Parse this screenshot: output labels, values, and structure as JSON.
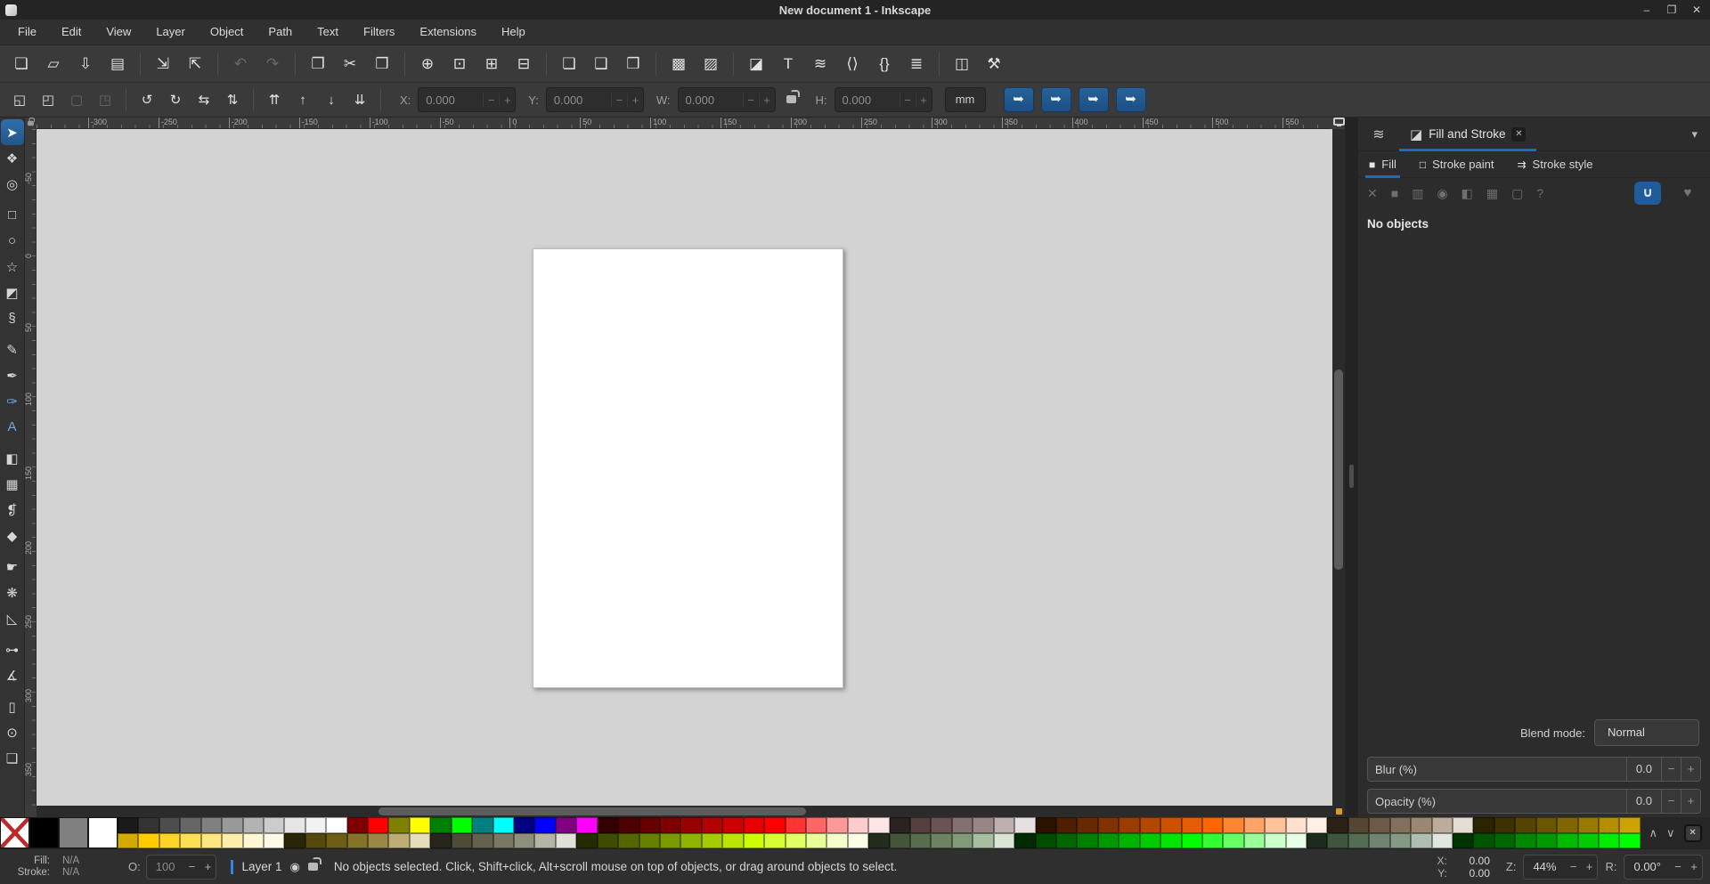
{
  "window": {
    "title": "New document 1 - Inkscape",
    "controls": [
      {
        "name": "minimize",
        "glyph": "–"
      },
      {
        "name": "restore",
        "glyph": "❐"
      },
      {
        "name": "close",
        "glyph": "✕"
      }
    ]
  },
  "menu": {
    "items": [
      "File",
      "Edit",
      "View",
      "Layer",
      "Object",
      "Path",
      "Text",
      "Filters",
      "Extensions",
      "Help"
    ]
  },
  "command_toolbar": {
    "groups": [
      [
        {
          "name": "new-document",
          "glyph": "❏"
        },
        {
          "name": "open-document",
          "glyph": "▱"
        },
        {
          "name": "save-document",
          "glyph": "⇩"
        },
        {
          "name": "print-document",
          "glyph": "▤"
        }
      ],
      [
        {
          "name": "import",
          "glyph": "⇲"
        },
        {
          "name": "export",
          "glyph": "⇱"
        }
      ],
      [
        {
          "name": "undo",
          "glyph": "↶",
          "disabled": true
        },
        {
          "name": "redo",
          "glyph": "↷",
          "disabled": true
        }
      ],
      [
        {
          "name": "copy",
          "glyph": "❐"
        },
        {
          "name": "cut",
          "glyph": "✂"
        },
        {
          "name": "paste",
          "glyph": "❒"
        }
      ],
      [
        {
          "name": "zoom-to-selection",
          "glyph": "⊕"
        },
        {
          "name": "zoom-to-drawing",
          "glyph": "⊡"
        },
        {
          "name": "zoom-to-page",
          "glyph": "⊞"
        },
        {
          "name": "zoom-page-width",
          "glyph": "⊟"
        }
      ],
      [
        {
          "name": "duplicate",
          "glyph": "❏"
        },
        {
          "name": "create-clone",
          "glyph": "❑"
        },
        {
          "name": "unlink-clone",
          "glyph": "❒"
        }
      ],
      [
        {
          "name": "group",
          "glyph": "▩"
        },
        {
          "name": "ungroup",
          "glyph": "▨"
        }
      ],
      [
        {
          "name": "fill-stroke-dialog",
          "glyph": "◪"
        },
        {
          "name": "text-dialog",
          "glyph": "T"
        },
        {
          "name": "layers-dialog",
          "glyph": "≋"
        },
        {
          "name": "xml-editor",
          "glyph": "⟨⟩"
        },
        {
          "name": "selectors-dialog",
          "glyph": "{}"
        },
        {
          "name": "align-distribute-dialog",
          "glyph": "≣"
        }
      ],
      [
        {
          "name": "document-properties",
          "glyph": "◫"
        },
        {
          "name": "preferences",
          "glyph": "⚒"
        }
      ]
    ]
  },
  "tool_controls": {
    "button_groups": [
      [
        {
          "name": "select-all",
          "glyph": "◱"
        },
        {
          "name": "select-all-layers",
          "glyph": "◰"
        },
        {
          "name": "deselect",
          "glyph": "▢",
          "disabled": true
        },
        {
          "name": "selection-cue-toggle",
          "glyph": "◳",
          "disabled": true
        }
      ],
      [
        {
          "name": "rotate-ccw",
          "glyph": "↺"
        },
        {
          "name": "rotate-cw",
          "glyph": "↻"
        },
        {
          "name": "flip-horizontal",
          "glyph": "⇆"
        },
        {
          "name": "flip-vertical",
          "glyph": "⇅"
        }
      ],
      [
        {
          "name": "raise-to-top",
          "glyph": "⇈"
        },
        {
          "name": "raise",
          "glyph": "↑"
        },
        {
          "name": "lower",
          "glyph": "↓"
        },
        {
          "name": "lower-to-bottom",
          "glyph": "⇊"
        }
      ]
    ],
    "fields": {
      "x": {
        "label": "X:",
        "value": "0.000"
      },
      "y": {
        "label": "Y:",
        "value": "0.000"
      },
      "w": {
        "label": "W:",
        "value": "0.000"
      },
      "h": {
        "label": "H:",
        "value": "0.000"
      }
    },
    "unit": "mm",
    "toggles": [
      {
        "name": "scale-stroke-width",
        "glyph": "➥"
      },
      {
        "name": "scale-rounded-corners",
        "glyph": "➥"
      },
      {
        "name": "move-gradients",
        "glyph": "➥"
      },
      {
        "name": "move-patterns",
        "glyph": "➥"
      }
    ]
  },
  "toolbox": {
    "tools": [
      {
        "name": "selector",
        "glyph": "➤",
        "active": true
      },
      {
        "name": "node-editor",
        "glyph": "❖"
      },
      {
        "name": "shape-builder",
        "glyph": "◎"
      },
      {
        "name": "rectangle",
        "glyph": "□",
        "grp": true
      },
      {
        "name": "ellipse",
        "glyph": "○"
      },
      {
        "name": "star",
        "glyph": "☆"
      },
      {
        "name": "box-3d",
        "glyph": "◩"
      },
      {
        "name": "spiral",
        "glyph": "§"
      },
      {
        "name": "pencil",
        "glyph": "✎",
        "grp": true
      },
      {
        "name": "pen",
        "glyph": "✒"
      },
      {
        "name": "calligraphy",
        "glyph": "✑"
      },
      {
        "name": "text",
        "glyph": "A"
      },
      {
        "name": "gradient",
        "glyph": "◧",
        "grp": true
      },
      {
        "name": "mesh-gradient",
        "glyph": "▦"
      },
      {
        "name": "dropper",
        "glyph": "❡"
      },
      {
        "name": "paint-bucket",
        "glyph": "◆"
      },
      {
        "name": "tweak",
        "glyph": "☛",
        "grp": true
      },
      {
        "name": "spray",
        "glyph": "❋"
      },
      {
        "name": "eraser",
        "glyph": "◺"
      },
      {
        "name": "connector",
        "glyph": "⊶",
        "grp": true
      },
      {
        "name": "measure",
        "glyph": "∡"
      },
      {
        "name": "page",
        "glyph": "▯",
        "grp": true
      },
      {
        "name": "zoom",
        "glyph": "⊙"
      },
      {
        "name": "pages",
        "glyph": "❏"
      }
    ]
  },
  "rulers": {
    "horizontal": [
      "-300",
      "-250",
      "-200",
      "-150",
      "-100",
      "-50",
      "0",
      "50",
      "100",
      "150",
      "200",
      "250",
      "300",
      "350",
      "400",
      "450",
      "500",
      "550"
    ],
    "vertical": [
      "-50",
      "0",
      "50",
      "100",
      "150",
      "200",
      "250",
      "300",
      "350"
    ]
  },
  "canvas": {
    "desk_color": "#d3d3d3",
    "page_color": "#ffffff"
  },
  "panel": {
    "dock_tab": "Fill and Stroke",
    "tabs": [
      {
        "name": "fill",
        "label": "Fill",
        "glyph": "■",
        "active": true
      },
      {
        "name": "stroke-paint",
        "label": "Stroke paint",
        "glyph": "□"
      },
      {
        "name": "stroke-style",
        "label": "Stroke style",
        "glyph": "⇉"
      }
    ],
    "paint_types": [
      {
        "name": "no-paint",
        "glyph": "✕"
      },
      {
        "name": "flat-color",
        "glyph": "■"
      },
      {
        "name": "linear-gradient",
        "glyph": "▥"
      },
      {
        "name": "radial-gradient",
        "glyph": "◉"
      },
      {
        "name": "pattern",
        "glyph": "◧"
      },
      {
        "name": "swatch",
        "glyph": "▦"
      },
      {
        "name": "unknown-paint",
        "glyph": "▢"
      },
      {
        "name": "paint-help",
        "glyph": "?"
      }
    ],
    "fill_rule": [
      {
        "name": "fill-rule-nonzero",
        "glyph": "∪",
        "active": true
      },
      {
        "name": "fill-rule-evenodd",
        "glyph": "♥"
      }
    ],
    "status": "No objects",
    "blend_label": "Blend mode:",
    "blend_value": "Normal",
    "blur_label": "Blur (%)",
    "blur_value": "0.0",
    "opacity_label": "Opacity (%)",
    "opacity_value": "0.0"
  },
  "palette": {
    "specials": [
      "none",
      "#000000",
      "#808080",
      "#ffffff"
    ],
    "row1": [
      "1a1a1a",
      "333333",
      "4d4d4d",
      "666666",
      "808080",
      "999999",
      "b3b3b3",
      "cccccc",
      "e6e6e6",
      "f2f2f2",
      "ffffff",
      "800000",
      "ff0000",
      "808000",
      "ffff00",
      "008000",
      "00ff00",
      "008080",
      "00ffff",
      "000080",
      "0000ff",
      "800080",
      "ff00ff",
      "330000",
      "4d0000",
      "660000",
      "800000",
      "990000",
      "b30000",
      "cc0000",
      "e60000",
      "ff0000",
      "ff3333",
      "ff6666",
      "ff9999",
      "ffcccc",
      "ffe6e6",
      "2b2222",
      "553f3f",
      "6c5353",
      "837070",
      "9a8585",
      "beb0b0",
      "e6e0e0",
      "2b1100",
      "4d1f00",
      "662900",
      "803300",
      "993d00",
      "b34700",
      "cc5200",
      "e65c00",
      "ff6600",
      "ff8533",
      "ffa366",
      "ffc299",
      "ffe0cc",
      "fff0e6",
      "2b2016",
      "554633",
      "6c5a47",
      "83705c",
      "9a8671",
      "beac9b",
      "e6ddd5",
      "2b2200",
      "3d3100",
      "554400",
      "6b5600",
      "806600",
      "997a00",
      "b38f00",
      "cca300"
    ],
    "row2": [
      "d4aa00",
      "ffcc00",
      "ffd42a",
      "ffdd55",
      "ffe680",
      "ffeeaa",
      "fff6d5",
      "fffbe6",
      "2b2507",
      "554a0e",
      "6c5e15",
      "837326",
      "9a8844",
      "beae76",
      "e6ddba",
      "26261d",
      "4c4c37",
      "62624f",
      "787865",
      "8f8f7d",
      "b5b5a6",
      "e0e0d8",
      "232b00",
      "3f4d00",
      "536600",
      "688000",
      "7c9900",
      "90b300",
      "a5cc00",
      "b9e600",
      "ccff00",
      "d6ff33",
      "e0ff66",
      "ebff99",
      "f5ffcc",
      "faffe6",
      "242b1c",
      "45553a",
      "596c4e",
      "6d8362",
      "829a77",
      "a8bea0",
      "dae6d5",
      "002b00",
      "004d00",
      "006600",
      "008000",
      "009900",
      "00b300",
      "00cc00",
      "00e600",
      "00ff00",
      "33ff33",
      "66ff66",
      "99ff99",
      "ccffcc",
      "e6ffe6",
      "1d2b1d",
      "3f553f",
      "536c53",
      "708370",
      "859a85",
      "b0beb0",
      "e0e6e0",
      "003300",
      "005500",
      "006600",
      "008800",
      "009900",
      "00bb00",
      "00cc00",
      "00ee00",
      "00ff00"
    ]
  },
  "statusbar": {
    "fill_label": "Fill:",
    "fill_value": "N/A",
    "stroke_label": "Stroke:",
    "stroke_value": "N/A",
    "opacity_label": "O:",
    "opacity_value": "100",
    "layer_name": "Layer 1",
    "message": "No objects selected. Click, Shift+click, Alt+scroll mouse on top of objects, or drag around objects to select.",
    "x_label": "X:",
    "x_value": "0.00",
    "y_label": "Y:",
    "y_value": "0.00",
    "zoom_label": "Z:",
    "zoom_value": "44%",
    "rotation_label": "R:",
    "rotation_value": "0.00°"
  },
  "colors": {
    "accent": "#1b6acb",
    "toggle_active": "#1f5c99",
    "desk": "#d3d3d3",
    "layer_indicator": "#3584e4"
  }
}
